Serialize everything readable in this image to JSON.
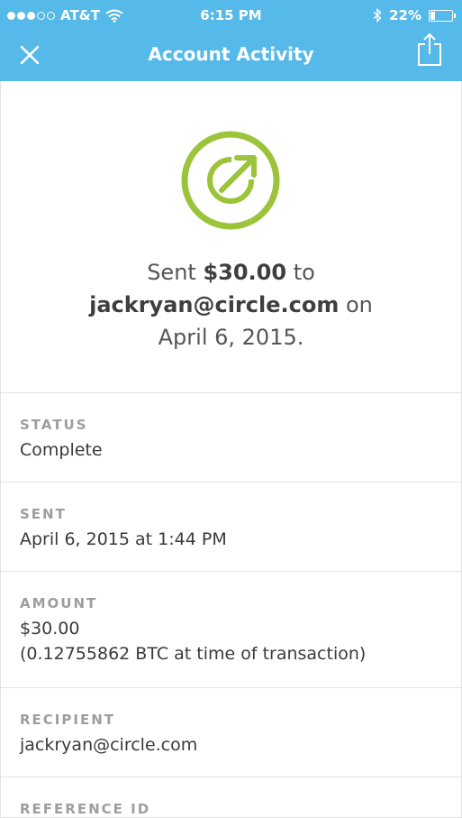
{
  "status_bar": {
    "carrier": "AT&T",
    "signal_bars_filled": 3,
    "signal_bars_total": 5,
    "time": "6:15 PM",
    "battery_percent": "22%",
    "battery_level": 0.22,
    "icons": [
      "wifi-icon",
      "bluetooth-icon",
      "battery-icon"
    ]
  },
  "nav": {
    "title": "Account Activity",
    "close_icon": "close-icon",
    "share_icon": "share-icon"
  },
  "hero": {
    "icon": "sent-arrow-icon",
    "summary_prefix": "Sent ",
    "amount": "$30.00",
    "summary_mid": " to",
    "recipient": "jackryan@circle.com",
    "summary_on": " on",
    "date": "April 6, 2015."
  },
  "fields": {
    "status": {
      "label": "STATUS",
      "value": "Complete"
    },
    "sent": {
      "label": "SENT",
      "value": "April 6, 2015 at 1:44 PM"
    },
    "amount": {
      "label": "AMOUNT",
      "value": "$30.00",
      "value2": "(0.12755862 BTC at time of transaction)"
    },
    "recipient": {
      "label": "RECIPIENT",
      "value": "jackryan@circle.com"
    },
    "reference": {
      "label": "REFERENCE ID"
    }
  },
  "colors": {
    "header_blue": "#55b9e9",
    "accent_green": "#9bc43a",
    "label_gray": "#9e9e9e",
    "text_dark": "#3a3a3a"
  }
}
